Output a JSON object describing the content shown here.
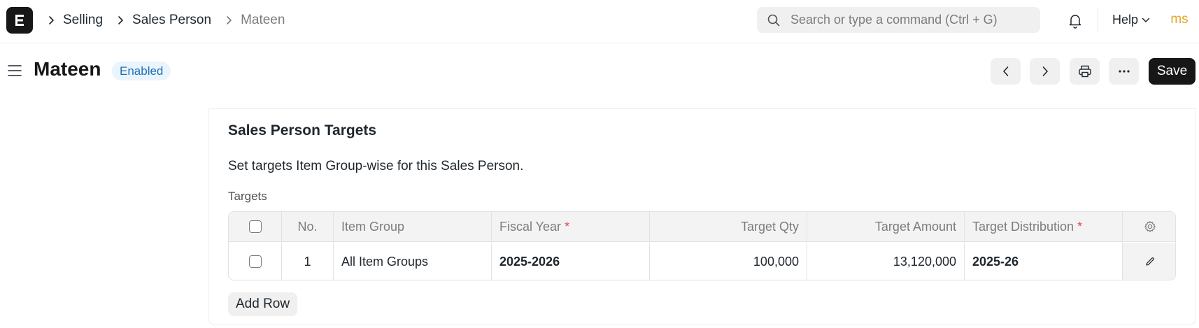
{
  "navbar": {
    "breadcrumbs": [
      "Selling",
      "Sales Person",
      "Mateen"
    ],
    "search_placeholder": "Search or type a command (Ctrl + G)",
    "help_label": "Help",
    "avatar_initials": "ms"
  },
  "page": {
    "title": "Mateen",
    "status": "Enabled",
    "save_label": "Save"
  },
  "section": {
    "title": "Sales Person Targets",
    "description": "Set targets Item Group-wise for this Sales Person.",
    "field_label": "Targets",
    "add_row_label": "Add Row"
  },
  "table": {
    "columns": {
      "no": "No.",
      "item_group": "Item Group",
      "fiscal_year": "Fiscal Year",
      "target_qty": "Target Qty",
      "target_amount": "Target Amount",
      "target_distribution": "Target Distribution",
      "required_mark": "*"
    },
    "rows": [
      {
        "no": "1",
        "item_group": "All Item Groups",
        "fiscal_year": "2025-2026",
        "target_qty": "100,000",
        "target_amount": "13,120,000",
        "target_distribution": "2025-26"
      }
    ]
  },
  "colors": {
    "primary_button": "#171717",
    "status_badge_bg": "#eaf4fc",
    "status_badge_text": "#1f6fb8",
    "required": "#e24c4c",
    "avatar": "#e6a82a"
  }
}
